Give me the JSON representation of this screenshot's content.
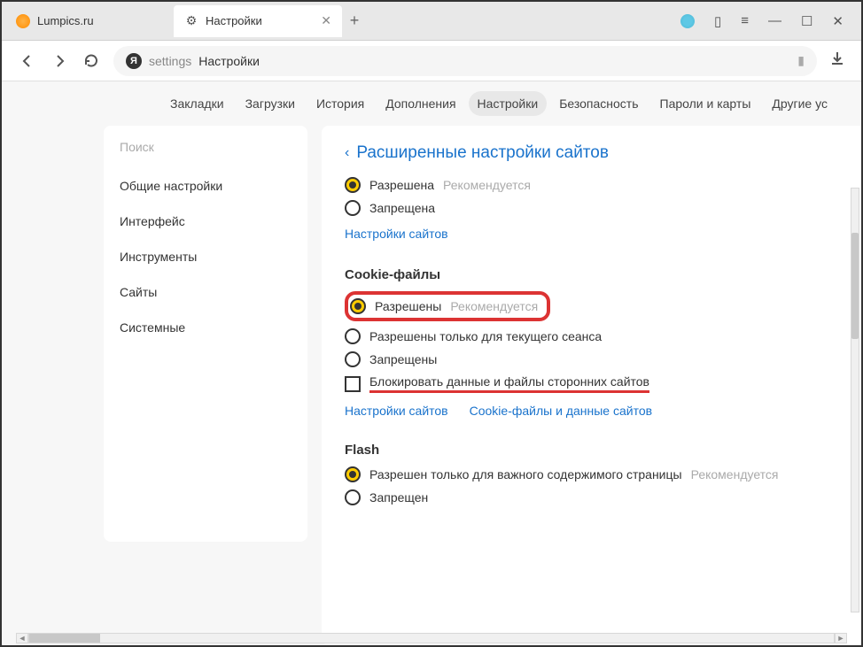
{
  "tabs": [
    {
      "title": "Lumpics.ru",
      "icon": "orange"
    },
    {
      "title": "Настройки",
      "icon": "gear"
    }
  ],
  "address": {
    "host": "settings",
    "title": "Настройки"
  },
  "topnav": {
    "items": [
      "Закладки",
      "Загрузки",
      "История",
      "Дополнения",
      "Настройки",
      "Безопасность",
      "Пароли и карты",
      "Другие ус"
    ],
    "active": 4
  },
  "sidebar": {
    "search_placeholder": "Поиск",
    "items": [
      "Общие настройки",
      "Интерфейс",
      "Инструменты",
      "Сайты",
      "Системные"
    ]
  },
  "panel": {
    "title": "Расширенные настройки сайтов",
    "section_top": {
      "options": [
        {
          "label": "Разрешена",
          "hint": "Рекомендуется",
          "selected": true
        },
        {
          "label": "Запрещена",
          "hint": "",
          "selected": false
        }
      ],
      "link": "Настройки сайтов"
    },
    "cookies": {
      "heading": "Cookie-файлы",
      "options": [
        {
          "label": "Разрешены",
          "hint": "Рекомендуется",
          "selected": true
        },
        {
          "label": "Разрешены только для текущего сеанса",
          "hint": "",
          "selected": false
        },
        {
          "label": "Запрещены",
          "hint": "",
          "selected": false
        }
      ],
      "checkbox_label": "Блокировать данные и файлы сторонних сайтов",
      "links": [
        "Настройки сайтов",
        "Cookie-файлы и данные сайтов"
      ]
    },
    "flash": {
      "heading": "Flash",
      "options": [
        {
          "label": "Разрешен только для важного содержимого страницы",
          "hint": "Рекомендуется",
          "selected": true
        },
        {
          "label": "Запрещен",
          "hint": "",
          "selected": false
        }
      ]
    }
  }
}
